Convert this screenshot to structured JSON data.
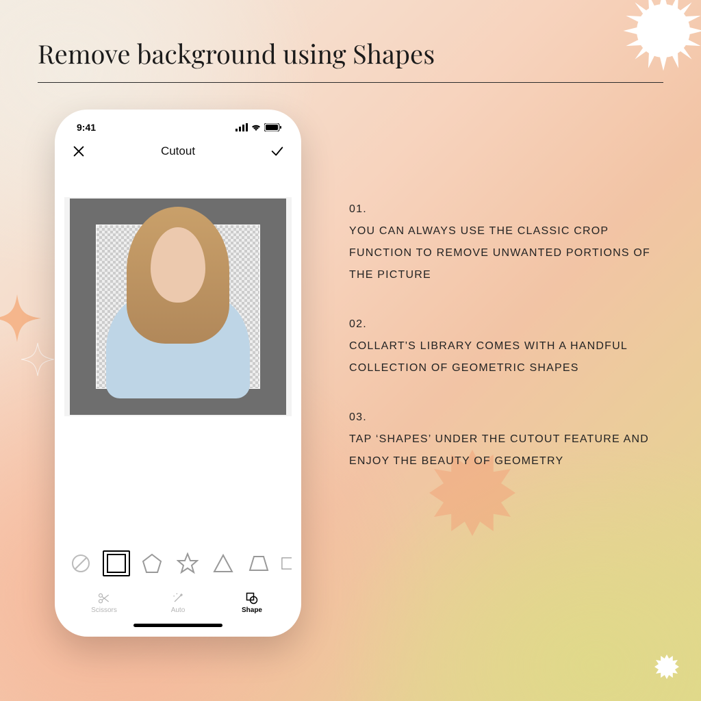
{
  "page": {
    "title": "Remove background using Shapes"
  },
  "phone": {
    "status": {
      "time": "9:41"
    },
    "nav": {
      "title": "Cutout"
    },
    "shapes": {
      "items": [
        {
          "name": "none"
        },
        {
          "name": "square",
          "selected": true
        },
        {
          "name": "pentagon"
        },
        {
          "name": "star"
        },
        {
          "name": "triangle"
        },
        {
          "name": "trapezoid"
        },
        {
          "name": "rectangle-partial"
        }
      ]
    },
    "tabs": {
      "scissors": "Scissors",
      "auto": "Auto",
      "shape": "Shape"
    }
  },
  "steps": [
    {
      "num": "01.",
      "text": "You can always use the classic crop function to remove unwanted portions of the picture"
    },
    {
      "num": "02.",
      "text": "Collart's library comes with a handful collection of geometric shapes"
    },
    {
      "num": "03.",
      "text": "Tap ‘Shapes’ under the cutout feature and enjoy the beauty of geometry"
    }
  ]
}
